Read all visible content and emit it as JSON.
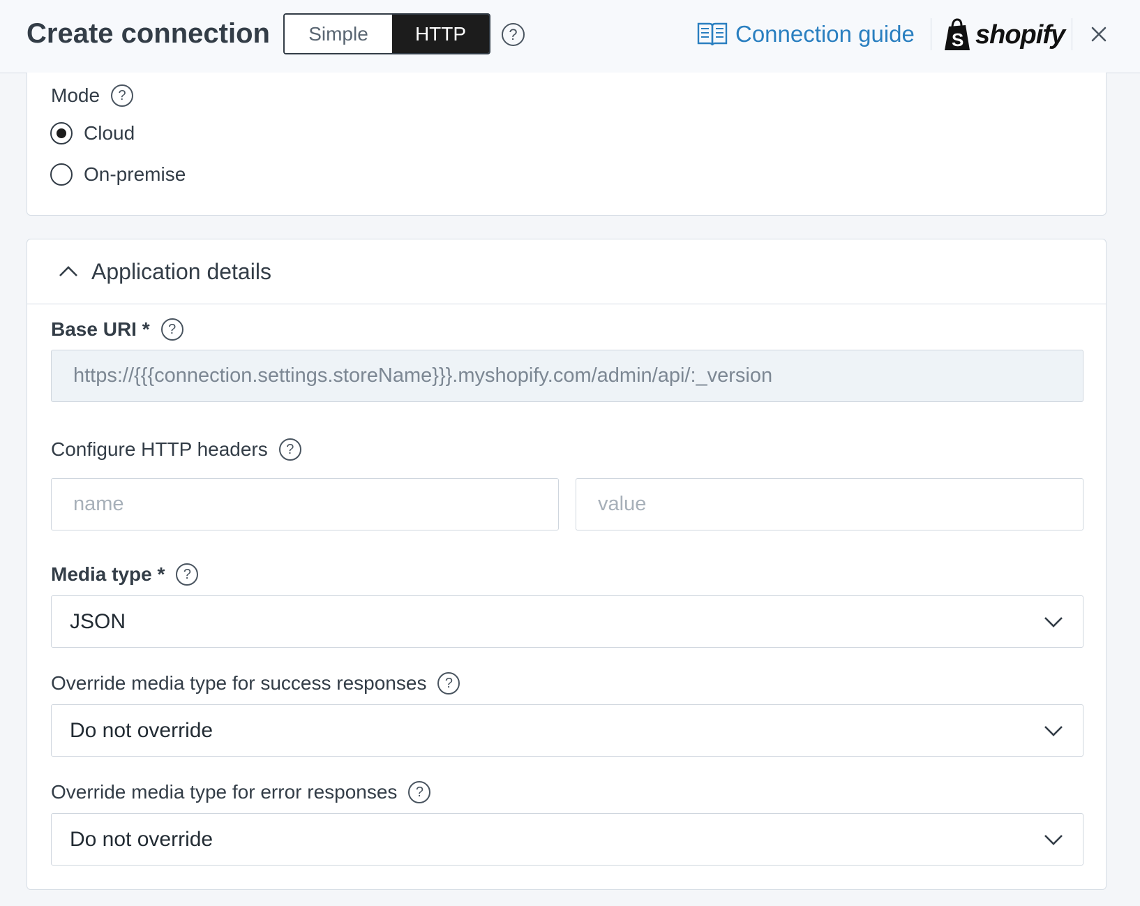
{
  "header": {
    "title": "Create connection",
    "toggle": {
      "simple_label": "Simple",
      "http_label": "HTTP",
      "selected": "HTTP"
    },
    "guide_label": "Connection guide",
    "brand": "shopify"
  },
  "mode": {
    "label": "Mode",
    "options": [
      {
        "label": "Cloud",
        "checked": true
      },
      {
        "label": "On-premise",
        "checked": false
      }
    ]
  },
  "app_details": {
    "title": "Application details",
    "base_uri": {
      "label": "Base URI *",
      "value": "https://{{{connection.settings.storeName}}}.myshopify.com/admin/api/:_version"
    },
    "headers": {
      "label": "Configure HTTP headers",
      "name_placeholder": "name",
      "value_placeholder": "value"
    },
    "media_type": {
      "label": "Media type *",
      "value": "JSON"
    },
    "success_override": {
      "label": "Override media type for success responses",
      "value": "Do not override"
    },
    "error_override": {
      "label": "Override media type for error responses",
      "value": "Do not override"
    }
  },
  "colors": {
    "accent_link": "#2a7fc0",
    "toggle_active": "#1c1c1c",
    "readonly_bg": "#eef3f7"
  }
}
